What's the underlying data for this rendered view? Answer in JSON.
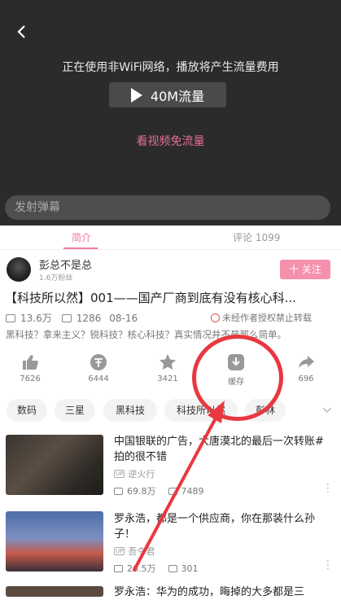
{
  "player": {
    "back_icon": "chevron-left-icon",
    "notice": "正在使用非WiFi网络，播放将产生流量费用",
    "play_button_label": "40M流量",
    "free_link": "看视频免流量"
  },
  "danmu": {
    "placeholder": "发射弹幕"
  },
  "tabs": {
    "intro": "简介",
    "comments": "评论 1099"
  },
  "author": {
    "name": "彭总不是总",
    "fans": "1.6万粉丝",
    "follow_label": "十 关注"
  },
  "video": {
    "title": "【科技所以然】001——国产厂商到底有没有核心科...",
    "views": "13.6万",
    "danmaku": "1286",
    "date": "08-16",
    "warning": "未经作者授权禁止转载",
    "description": "黑科技？拿来主义？锐科技？核心科技？真实情况并不是那么简单。"
  },
  "actions": [
    {
      "icon": "thumbs-up-icon",
      "label": "7626"
    },
    {
      "icon": "coin-icon",
      "label": "6444"
    },
    {
      "icon": "star-icon",
      "label": "3421"
    },
    {
      "icon": "download-icon",
      "label": "缓存"
    },
    {
      "icon": "share-icon",
      "label": "696"
    }
  ],
  "tags": [
    "数码",
    "三星",
    "黑科技",
    "科技所以然",
    "彭林"
  ],
  "related": [
    {
      "title": "中国银联的广告，大唐漠北的最后一次转账#拍的很不错",
      "up": "逆火行",
      "views": "69.8万",
      "danmaku": "7489"
    },
    {
      "title": "罗永浩，都是一个供应商，你在那装什么孙子！",
      "up": "吾令君",
      "views": "26.5万",
      "danmaku": "301"
    },
    {
      "title": "罗永浩：华为的成功，晦掉的大多都是三"
    }
  ],
  "colors": {
    "accent": "#f07a9a",
    "annotation": "#e8383f",
    "player_bg": "#2b2b2c"
  }
}
